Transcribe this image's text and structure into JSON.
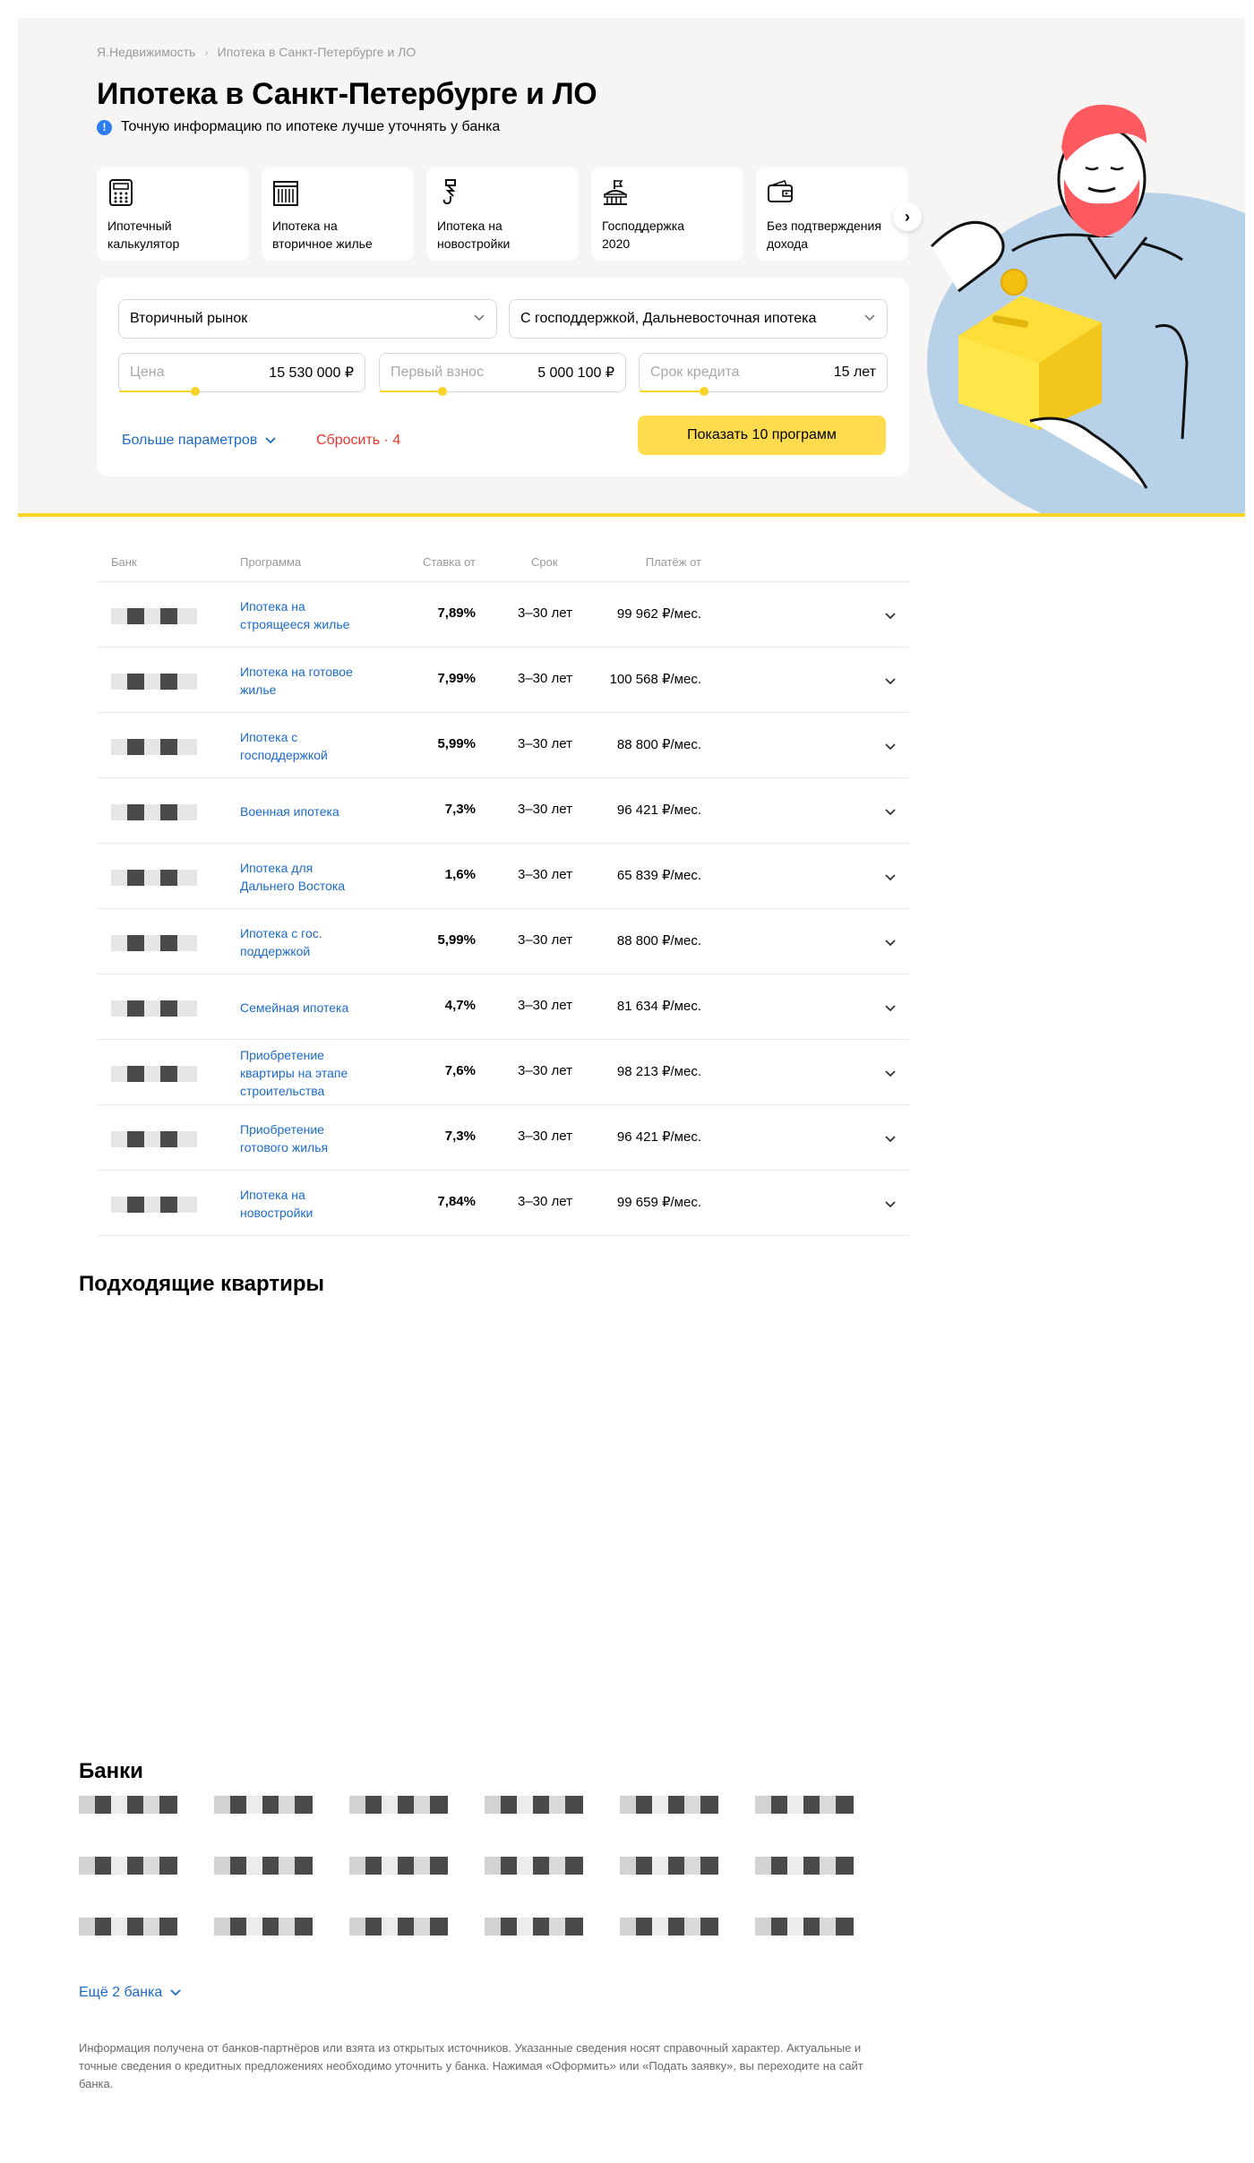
{
  "breadcrumb": [
    "Я.Недвижимость",
    "Ипотека в Санкт-Петербурге и ЛО"
  ],
  "breadcrumb_sep": "›",
  "page_title": "Ипотека в Санкт-Петербурге и ЛО",
  "notice": "Точную информацию по ипотеке лучше уточнять у банка",
  "cards": [
    {
      "label": "Ипотечный\nкалькулятор",
      "icon": "calculator-icon"
    },
    {
      "label": "Ипотека на\nвторичное жилье",
      "icon": "building-icon"
    },
    {
      "label": "Ипотека на\nновостройки",
      "icon": "crane-hook-icon"
    },
    {
      "label": "Господдержка\n2020",
      "icon": "government-icon"
    },
    {
      "label": "Без подтверждения\nдохода",
      "icon": "wallet-icon"
    }
  ],
  "filters": {
    "market": "Вторичный рынок",
    "programs": "С господдержкой, Дальневосточная ипотека",
    "price_label": "Цена",
    "price_value": "15 530 000 ₽",
    "down_label": "Первый взнос",
    "down_value": "5 000 100 ₽",
    "term_label": "Срок кредита",
    "term_value": "15 лет",
    "more_params": "Больше параметров",
    "reset": "Сбросить · 4",
    "show_button": "Показать 10 программ"
  },
  "table": {
    "headers": {
      "bank": "Банк",
      "program": "Программа",
      "rate": "Ставка от",
      "term": "Срок",
      "payment": "Платёж от"
    },
    "rows": [
      {
        "program": "Ипотека на\nстроящееся жилье",
        "rate": "7,89%",
        "term": "3–30 лет",
        "payment": "99 962 ₽/мес."
      },
      {
        "program": "Ипотека на готовое\nжилье",
        "rate": "7,99%",
        "term": "3–30 лет",
        "payment": "100 568 ₽/мес."
      },
      {
        "program": "Ипотека с\nгосподдержкой",
        "rate": "5,99%",
        "term": "3–30 лет",
        "payment": "88 800 ₽/мес."
      },
      {
        "program": "Военная ипотека",
        "rate": "7,3%",
        "term": "3–30 лет",
        "payment": "96 421 ₽/мес."
      },
      {
        "program": "Ипотека для\nДальнего Востока",
        "rate": "1,6%",
        "term": "3–30 лет",
        "payment": "65 839 ₽/мес."
      },
      {
        "program": "Ипотека с гос.\nподдержкой",
        "rate": "5,99%",
        "term": "3–30 лет",
        "payment": "88 800 ₽/мес."
      },
      {
        "program": "Семейная ипотека",
        "rate": "4,7%",
        "term": "3–30 лет",
        "payment": "81 634 ₽/мес."
      },
      {
        "program": "Приобретение\nквартиры на этапе\nстроительства",
        "rate": "7,6%",
        "term": "3–30 лет",
        "payment": "98 213 ₽/мес."
      },
      {
        "program": "Приобретение\nготового жилья",
        "rate": "7,3%",
        "term": "3–30 лет",
        "payment": "96 421 ₽/мес."
      },
      {
        "program": "Ипотека на\nновостройки",
        "rate": "7,84%",
        "term": "3–30 лет",
        "payment": "99 659 ₽/мес."
      }
    ]
  },
  "apartments_title": "Подходящие квартиры",
  "banks_title": "Банки",
  "banks_count": 18,
  "more_banks": "Ещё 2 банка",
  "disclaimer": "Информация получена от банков-партнёров или взята из открытых источников. Указанные сведения носят справочный характер. Актуальные и точные сведения о кредитных предложениях необходимо уточнить у банка. Нажимая «Оформить» или «Подать заявку», вы переходите на сайт банка.",
  "colors": {
    "accent_yellow": "#ffdc4d",
    "link_blue": "#1b6ac9",
    "reset_red": "#e8352c",
    "hero_bg": "#f6f5f3",
    "info_blue": "#2d7cf0"
  }
}
